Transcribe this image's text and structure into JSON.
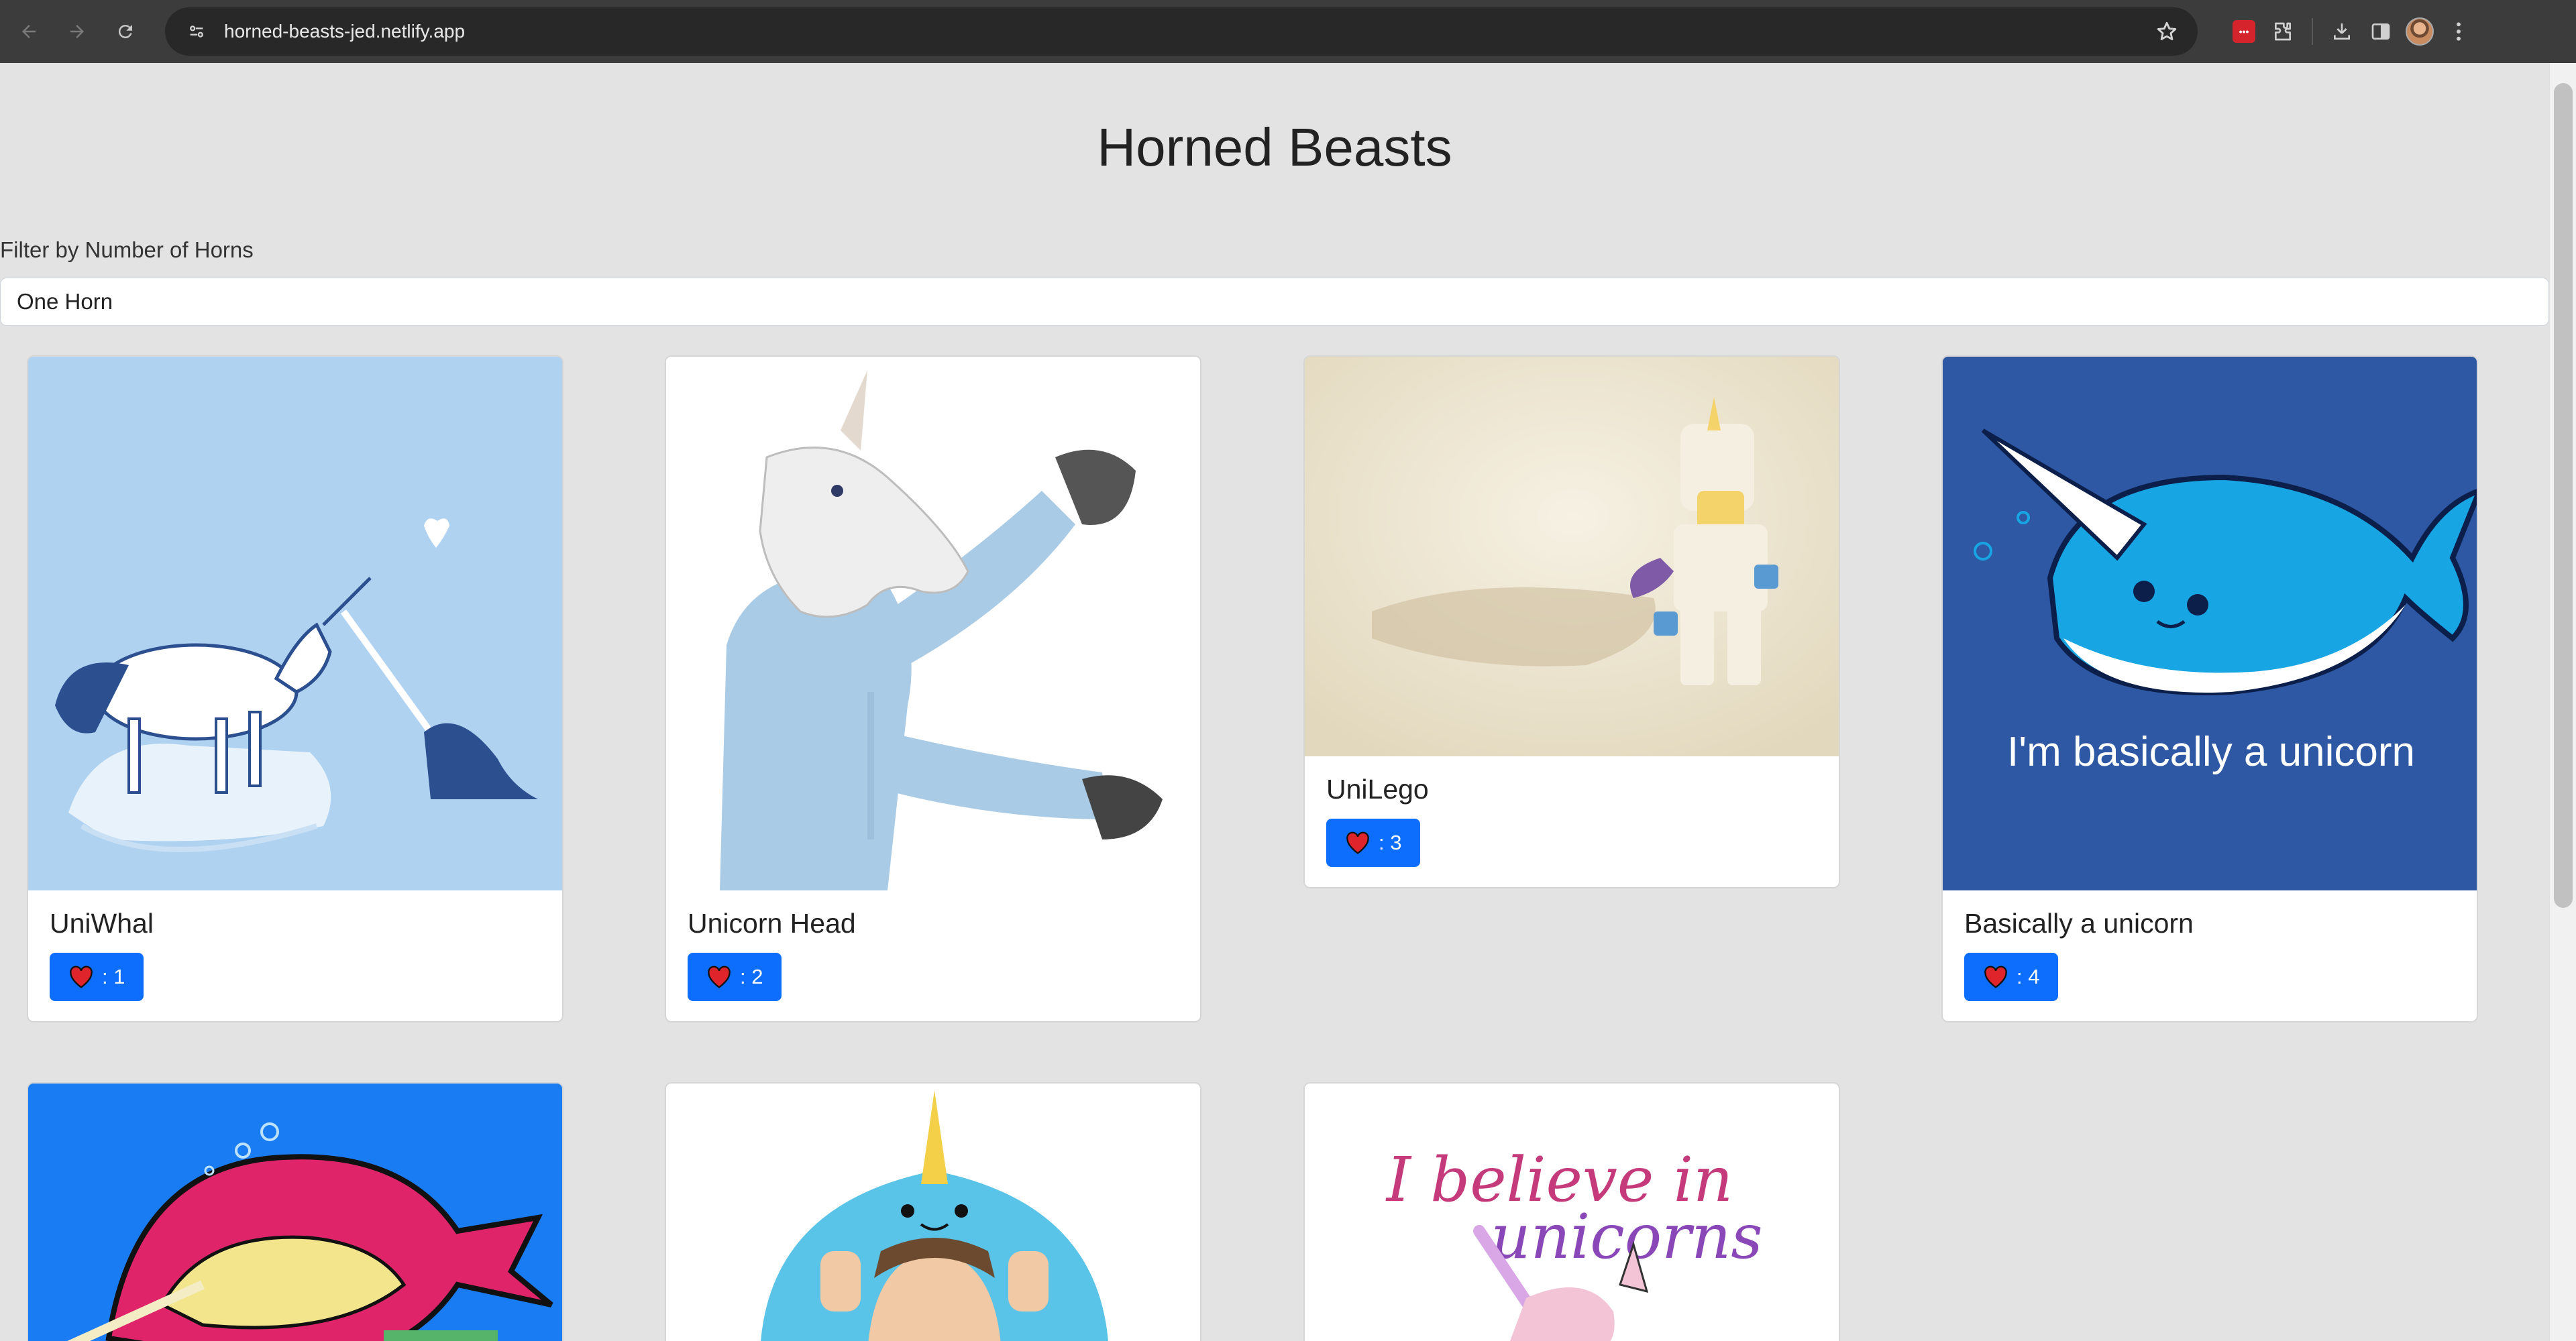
{
  "browser": {
    "url": "horned-beasts-jed.netlify.app"
  },
  "page": {
    "title": "Horned Beasts",
    "filter": {
      "label": "Filter by Number of Horns",
      "selected": "One Horn"
    },
    "cards": [
      {
        "title": "UniWhal",
        "likes": "1",
        "like_text": ": 1"
      },
      {
        "title": "Unicorn Head",
        "likes": "2",
        "like_text": ": 2"
      },
      {
        "title": "UniLego",
        "likes": "3",
        "like_text": ": 3"
      },
      {
        "title": "Basically a unicorn",
        "likes": "4",
        "like_text": ": 4",
        "image_text": "I'm basically a unicorn"
      },
      {
        "title": "",
        "likes": ""
      },
      {
        "title": "",
        "likes": ""
      },
      {
        "title": "",
        "likes": "",
        "image_text_line1": "I believe in",
        "image_text_line2": "unicorns"
      }
    ]
  },
  "colors": {
    "accent": "#0d6efd",
    "page_bg": "#e3e3e3",
    "chrome_bg": "#3c3c3c"
  }
}
